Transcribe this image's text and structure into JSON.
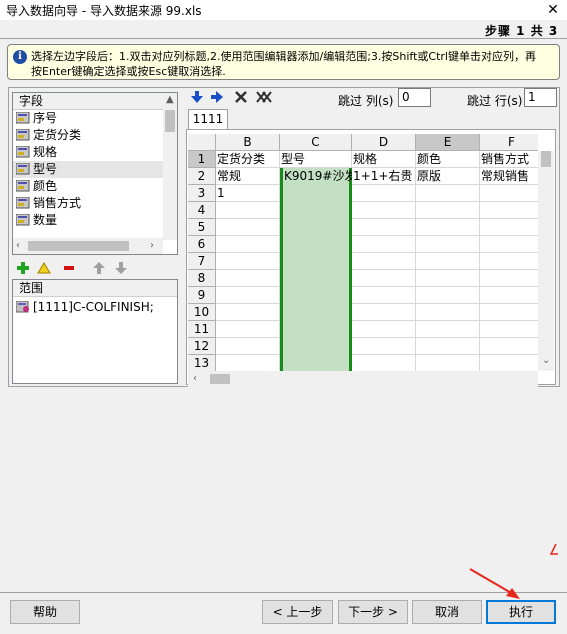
{
  "window": {
    "title": "导入数据向导 - 导入数据来源 99.xls",
    "close_glyph": "✕",
    "step": "步骤 1 共 3"
  },
  "info": {
    "line1": "选择左边字段后：1.双击对应列标题,2.使用范围编辑器添加/编辑范围;3.按Shift或Ctrl键单击对应列，再",
    "line2": "按Enter键确定选择或按Esc键取消选择."
  },
  "fields": {
    "header": "字段",
    "items": [
      "序号",
      "定货分类",
      "规格",
      "型号",
      "颜色",
      "销售方式",
      "数量"
    ],
    "selected_index": 3
  },
  "range": {
    "header": "范围",
    "item": "[1111]C-COLFINISH;"
  },
  "toolbar": {
    "skip_col_label": "跳过 列(s)",
    "skip_col_value": "0",
    "skip_row_label": "跳过 行(s)",
    "skip_row_value": "1"
  },
  "sheet": {
    "tab": "1111",
    "columns": [
      "B",
      "C",
      "D",
      "E",
      "F"
    ],
    "active_column": "E",
    "highlight_column": "C",
    "rows": [
      "1",
      "2",
      "3",
      "4",
      "5",
      "6",
      "7",
      "8",
      "9",
      "10",
      "11",
      "12",
      "13"
    ],
    "cells": [
      [
        "定货分类",
        "型号",
        "规格",
        "颜色",
        "销售方式"
      ],
      [
        "常规",
        "K9019#沙发",
        "1+1+右贵",
        "原版",
        "常规销售"
      ],
      [
        "1",
        "",
        "",
        "",
        ""
      ]
    ]
  },
  "buttons": {
    "help": "帮助",
    "prev": "< 上一步",
    "next": "下一步 >",
    "cancel": "取消",
    "execute": "执行"
  },
  "colors": {
    "highlight_fill": "#c3e0c3",
    "highlight_border": "#1a8a1a",
    "annotation_arrow": "#e8271b",
    "info_bg": "#ffffe1"
  }
}
